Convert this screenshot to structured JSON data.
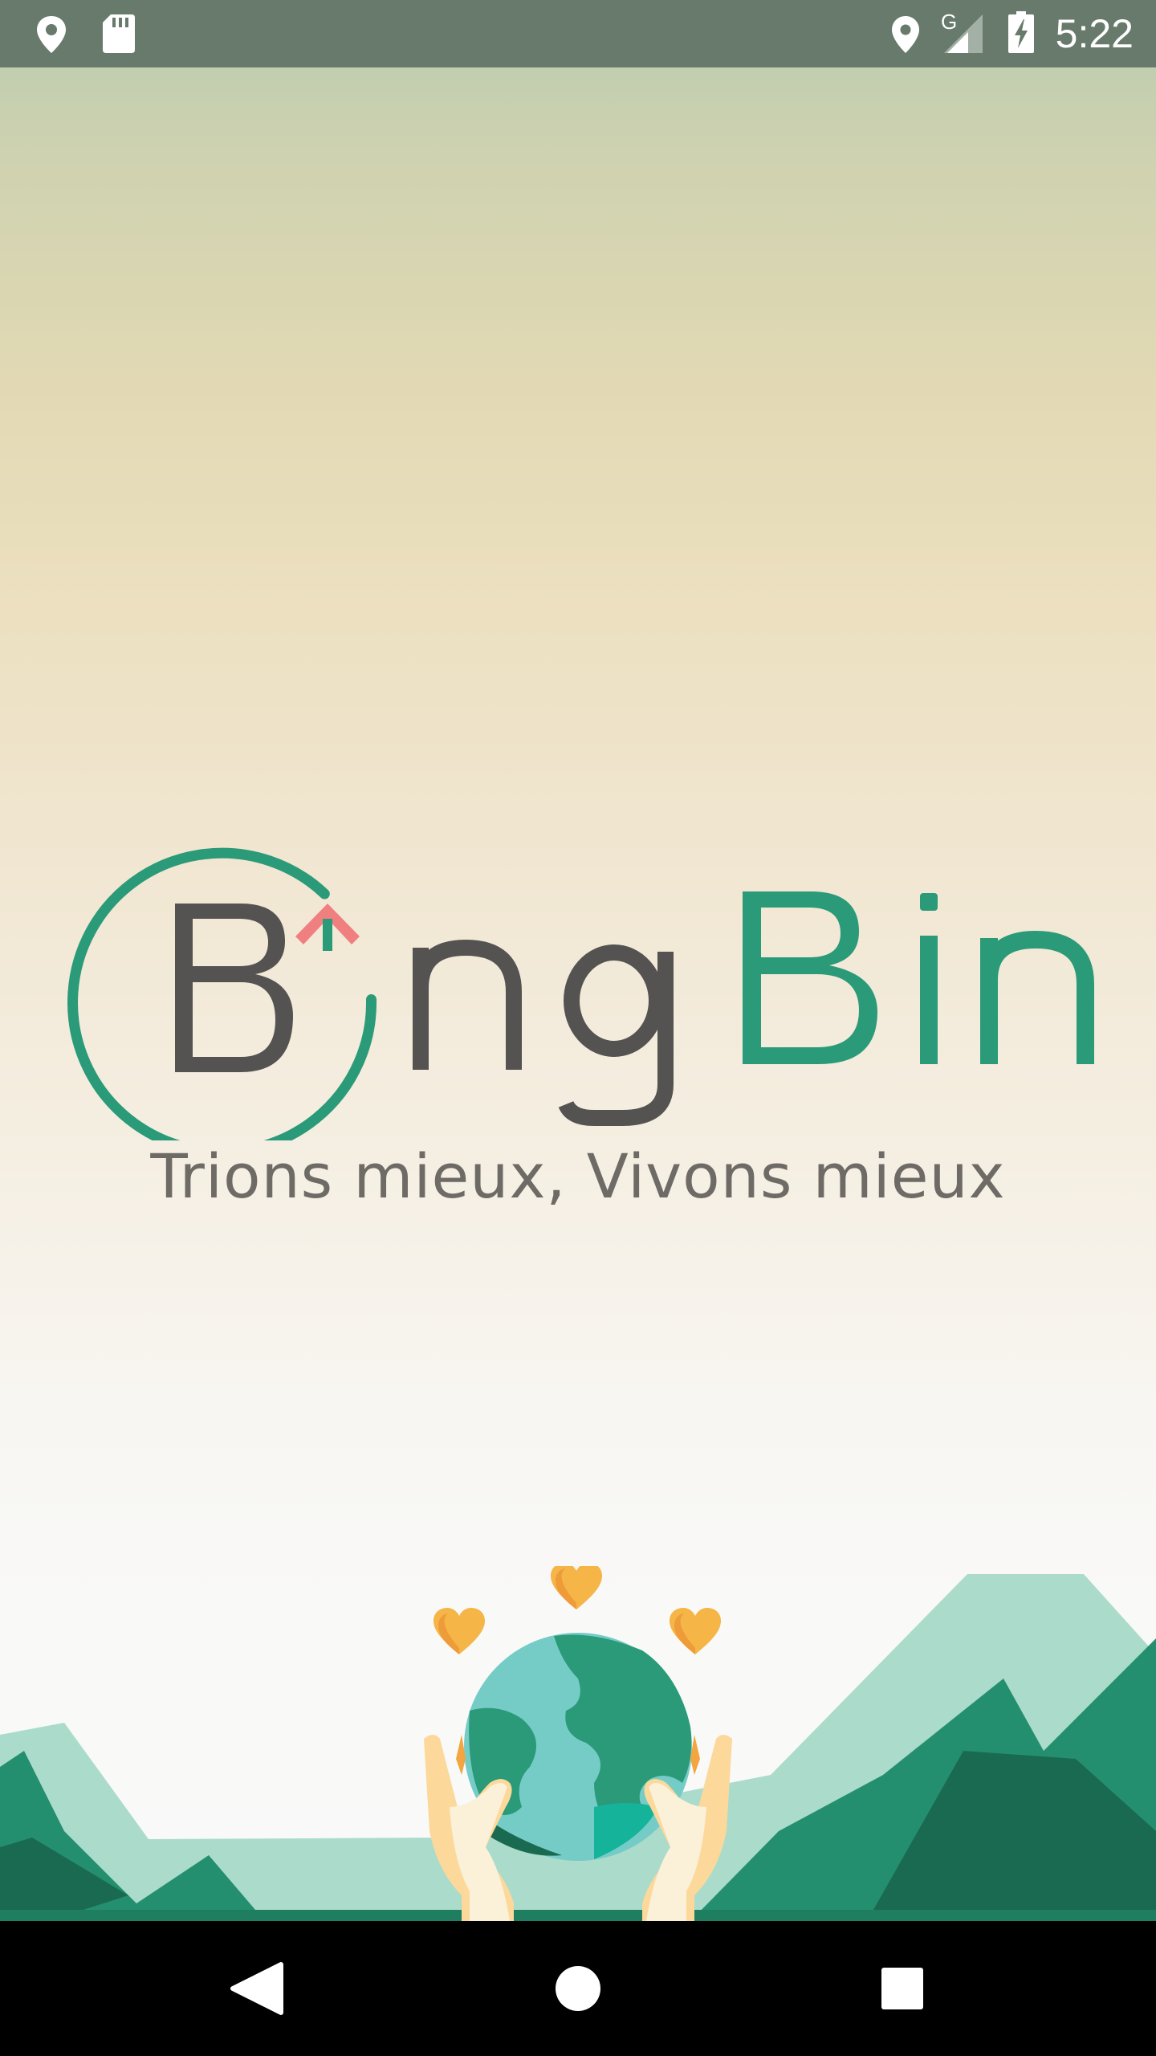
{
  "status_bar": {
    "time": "5:22",
    "network_type": "G",
    "icons": [
      "location-icon",
      "sd-card-icon",
      "location-icon",
      "signal-icon",
      "battery-charging-icon"
    ]
  },
  "logo": {
    "word_bing": "Bing",
    "word_bin": "Bin",
    "colors": {
      "dark": "#545352",
      "green": "#2a9a78",
      "arrow": "#f08080"
    }
  },
  "tagline": "Trions mieux, Vivons mieux",
  "navigation": {
    "buttons": [
      "back-icon",
      "home-icon",
      "recents-icon"
    ]
  },
  "colors": {
    "status_bar": "#677a6c",
    "nav_bar": "#000000",
    "tagline": "#6e6a66"
  }
}
